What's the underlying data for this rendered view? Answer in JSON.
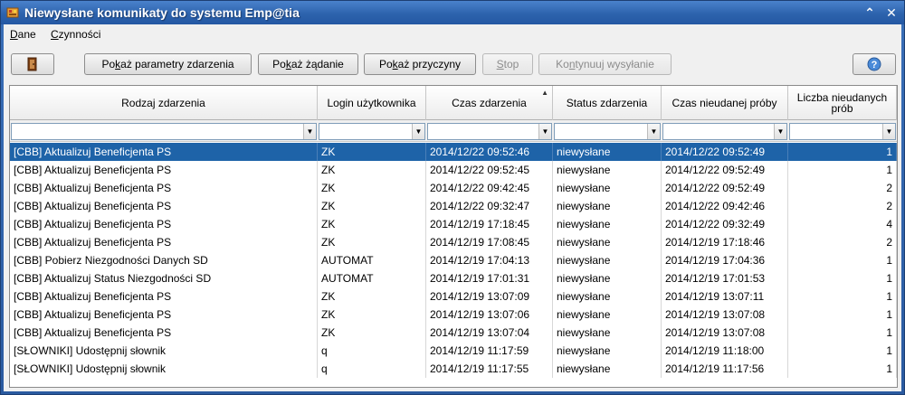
{
  "window": {
    "title": "Niewysłane komunikaty do systemu Emp@tia",
    "collapse_glyph": "⌃",
    "close_glyph": "✕"
  },
  "menu": {
    "items": [
      {
        "pre": "",
        "accel": "D",
        "post": "ane"
      },
      {
        "pre": "",
        "accel": "C",
        "post": "zynności"
      }
    ]
  },
  "toolbar": {
    "exit_icon": "exit-door-icon",
    "buttons": [
      {
        "pre": "Po",
        "accel": "k",
        "post": "aż parametry zdarzenia",
        "enabled": true
      },
      {
        "pre": "Po",
        "accel": "k",
        "post": "aż żądanie",
        "enabled": true
      },
      {
        "pre": "Po",
        "accel": "k",
        "post": "aż przyczyny",
        "enabled": true
      },
      {
        "pre": "",
        "accel": "S",
        "post": "top",
        "enabled": false
      },
      {
        "pre": "Ko",
        "accel": "n",
        "post": "tynuuj wysyłanie",
        "enabled": false
      }
    ],
    "help_icon": "help-icon"
  },
  "grid": {
    "columns": [
      "Rodzaj zdarzenia",
      "Login użytkownika",
      "Czas zdarzenia",
      "Status zdarzenia",
      "Czas nieudanej próby",
      "Liczba nieudanych prób"
    ],
    "sort_glyph": "▲",
    "filter_glyph": "▼",
    "rows": [
      [
        "[CBB] Aktualizuj Beneficjenta PS",
        "ZK",
        "2014/12/22 09:52:46",
        "niewysłane",
        "2014/12/22 09:52:49",
        "1"
      ],
      [
        "[CBB] Aktualizuj Beneficjenta PS",
        "ZK",
        "2014/12/22 09:52:45",
        "niewysłane",
        "2014/12/22 09:52:49",
        "1"
      ],
      [
        "[CBB] Aktualizuj Beneficjenta PS",
        "ZK",
        "2014/12/22 09:42:45",
        "niewysłane",
        "2014/12/22 09:52:49",
        "2"
      ],
      [
        "[CBB] Aktualizuj Beneficjenta PS",
        "ZK",
        "2014/12/22 09:32:47",
        "niewysłane",
        "2014/12/22 09:42:46",
        "2"
      ],
      [
        "[CBB] Aktualizuj Beneficjenta PS",
        "ZK",
        "2014/12/19 17:18:45",
        "niewysłane",
        "2014/12/22 09:32:49",
        "4"
      ],
      [
        "[CBB] Aktualizuj Beneficjenta PS",
        "ZK",
        "2014/12/19 17:08:45",
        "niewysłane",
        "2014/12/19 17:18:46",
        "2"
      ],
      [
        "[CBB] Pobierz Niezgodności Danych SD",
        "AUTOMAT",
        "2014/12/19 17:04:13",
        "niewysłane",
        "2014/12/19 17:04:36",
        "1"
      ],
      [
        "[CBB] Aktualizuj Status Niezgodności SD",
        "AUTOMAT",
        "2014/12/19 17:01:31",
        "niewysłane",
        "2014/12/19 17:01:53",
        "1"
      ],
      [
        "[CBB] Aktualizuj Beneficjenta PS",
        "ZK",
        "2014/12/19 13:07:09",
        "niewysłane",
        "2014/12/19 13:07:11",
        "1"
      ],
      [
        "[CBB] Aktualizuj Beneficjenta PS",
        "ZK",
        "2014/12/19 13:07:06",
        "niewysłane",
        "2014/12/19 13:07:08",
        "1"
      ],
      [
        "[CBB] Aktualizuj Beneficjenta PS",
        "ZK",
        "2014/12/19 13:07:04",
        "niewysłane",
        "2014/12/19 13:07:08",
        "1"
      ],
      [
        "[SŁOWNIKI] Udostępnij słownik",
        "q",
        "2014/12/19 11:17:59",
        "niewysłane",
        "2014/12/19 11:18:00",
        "1"
      ],
      [
        "[SŁOWNIKI] Udostępnij słownik",
        "q",
        "2014/12/19 11:17:55",
        "niewysłane",
        "2014/12/19 11:17:56",
        "1"
      ]
    ],
    "selected_row": 0
  },
  "colors": {
    "titlebar": "#2d63ad",
    "selection": "#1e63a8"
  }
}
